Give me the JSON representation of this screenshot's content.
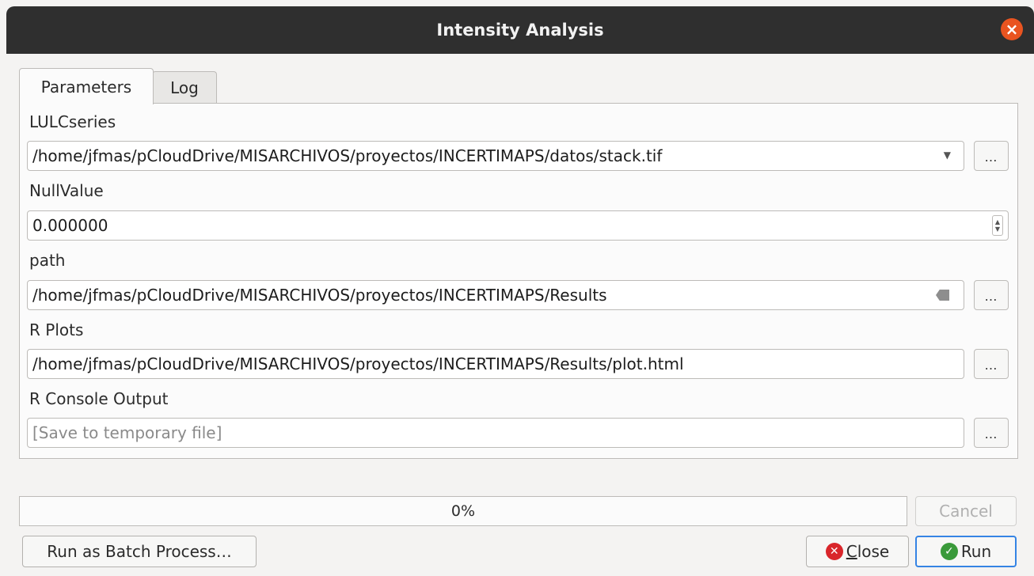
{
  "window": {
    "title": "Intensity Analysis"
  },
  "tabs": [
    {
      "label": "Parameters",
      "active": true
    },
    {
      "label": "Log",
      "active": false
    }
  ],
  "params": {
    "lulc": {
      "label": "LULCseries",
      "value": "/home/jfmas/pCloudDrive/MISARCHIVOS/proyectos/INCERTIMAPS/datos/stack.tif"
    },
    "nullvalue": {
      "label": "NullValue",
      "value": "0.000000"
    },
    "path": {
      "label": "path",
      "value": "/home/jfmas/pCloudDrive/MISARCHIVOS/proyectos/INCERTIMAPS/Results"
    },
    "rplots": {
      "label": "R Plots",
      "value": "/home/jfmas/pCloudDrive/MISARCHIVOS/proyectos/INCERTIMAPS/Results/plot.html"
    },
    "rconsole": {
      "label": "R Console Output",
      "placeholder": "[Save to temporary file]"
    },
    "browse_label": "…"
  },
  "progress": {
    "text": "0%",
    "value": 0
  },
  "buttons": {
    "cancel": "Cancel",
    "batch": "Run as Batch Process…",
    "close_first": "C",
    "close_rest": "lose",
    "run": "Run"
  },
  "colors": {
    "accent": "#3584e4",
    "titlebar": "#2f2f2f",
    "close": "#e95420"
  }
}
